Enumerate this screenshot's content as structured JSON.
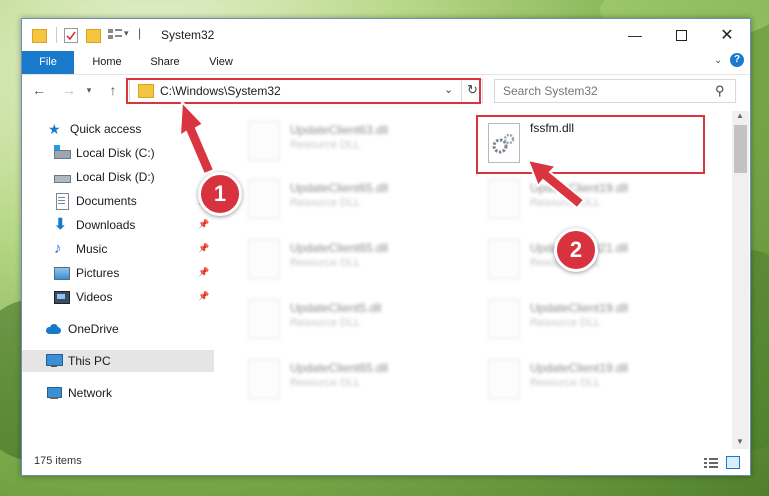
{
  "window": {
    "title": "System32"
  },
  "ribbon": {
    "tabs": [
      "File",
      "Home",
      "Share",
      "View"
    ]
  },
  "address": {
    "path": "C:\\Windows\\System32"
  },
  "search": {
    "placeholder": "Search System32"
  },
  "nav": {
    "items": [
      {
        "label": "Quick access",
        "icon": "star-icon"
      },
      {
        "label": "Local Disk (C:)",
        "icon": "drive-icon"
      },
      {
        "label": "Local Disk (D:)",
        "icon": "drive-icon"
      },
      {
        "label": "Documents",
        "icon": "documents-icon"
      },
      {
        "label": "Downloads",
        "icon": "download-icon"
      },
      {
        "label": "Music",
        "icon": "music-icon"
      },
      {
        "label": "Pictures",
        "icon": "pictures-icon"
      },
      {
        "label": "Videos",
        "icon": "videos-icon"
      },
      {
        "label": "OneDrive",
        "icon": "cloud-icon"
      },
      {
        "label": "This PC",
        "icon": "computer-icon"
      },
      {
        "label": "Network",
        "icon": "network-icon"
      }
    ]
  },
  "files": {
    "selected": {
      "name": "fssfm.dll"
    },
    "faded": [
      {
        "name": "UpdateClient63.dll",
        "type": "Resource DLL"
      },
      {
        "name": "UpdateClient65.dll",
        "type": "Resource DLL"
      },
      {
        "name": "UpdateClient19.dll",
        "type": "Resource DLL"
      },
      {
        "name": "UpdateClient65.dll",
        "type": "Resource DLL"
      },
      {
        "name": "UpdateClient21.dll",
        "type": "Resource DLL"
      },
      {
        "name": "UpdateClient5.dll",
        "type": "Resource DLL"
      },
      {
        "name": "UpdateClient19.dll",
        "type": "Resource DLL"
      },
      {
        "name": "UpdateClient65.dll",
        "type": "Resource DLL"
      },
      {
        "name": "UpdateClient19.dll",
        "type": "Resource DLL"
      }
    ]
  },
  "status": {
    "count": "175 items"
  },
  "annotations": {
    "step1": "1",
    "step2": "2"
  },
  "colors": {
    "accent": "#1979ca",
    "annotation": "#d9343f"
  }
}
